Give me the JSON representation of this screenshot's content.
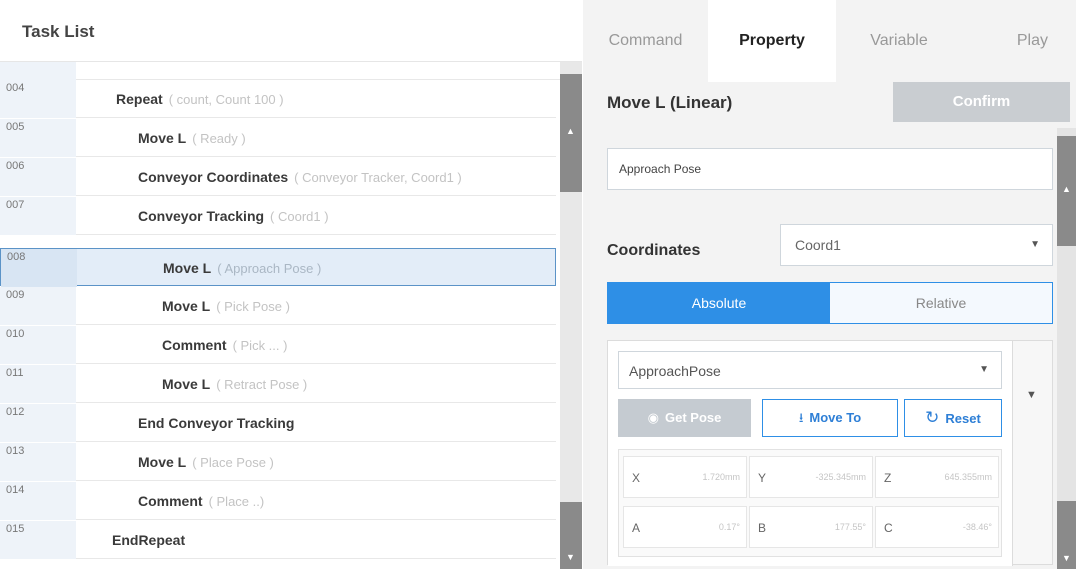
{
  "task_list": {
    "title": "Task List",
    "rows": [
      {
        "num": "004",
        "command": "Repeat",
        "param": "( count, Count 100 )"
      },
      {
        "num": "005",
        "command": "Move L",
        "param": "( Ready )"
      },
      {
        "num": "006",
        "command": "Conveyor Coordinates",
        "param": "( Conveyor Tracker, Coord1 )"
      },
      {
        "num": "007",
        "command": "Conveyor Tracking",
        "param": "( Coord1 )"
      },
      {
        "num": "008",
        "command": "Move L",
        "param": "( Approach Pose )"
      },
      {
        "num": "009",
        "command": "Move L",
        "param": "( Pick Pose )"
      },
      {
        "num": "010",
        "command": "Comment",
        "param": "( Pick ... )"
      },
      {
        "num": "011",
        "command": "Move L",
        "param": "( Retract Pose )"
      },
      {
        "num": "012",
        "command": "End Conveyor Tracking",
        "param": ""
      },
      {
        "num": "013",
        "command": "Move L",
        "param": "( Place Pose )"
      },
      {
        "num": "014",
        "command": "Comment",
        "param": "( Place ..)"
      },
      {
        "num": "015",
        "command": "EndRepeat",
        "param": ""
      }
    ]
  },
  "tabs": [
    {
      "label": "Command"
    },
    {
      "label": "Property"
    },
    {
      "label": "Variable"
    },
    {
      "label": "Play"
    }
  ],
  "property": {
    "title": "Move L (Linear)",
    "confirm_label": "Confirm",
    "pose_name": "Approach Pose",
    "coordinates_label": "Coordinates",
    "coordinates_value": "Coord1",
    "absolute_label": "Absolute",
    "relative_label": "Relative",
    "pose_variable": "ApproachPose",
    "get_pose_label": "Get Pose",
    "move_to_label": "Move To",
    "reset_label": "Reset",
    "fields": [
      {
        "label": "X",
        "value": "1.720mm"
      },
      {
        "label": "Y",
        "value": "-325.345mm"
      },
      {
        "label": "Z",
        "value": "645.355mm"
      },
      {
        "label": "A",
        "value": "0.17°"
      },
      {
        "label": "B",
        "value": "177.55°"
      },
      {
        "label": "C",
        "value": "-38.46°"
      }
    ]
  },
  "icons": {
    "caret": "caret-down-icon",
    "get_pose": "target-icon",
    "move_to": "download-arrow-icon",
    "reset": "refresh-icon"
  }
}
